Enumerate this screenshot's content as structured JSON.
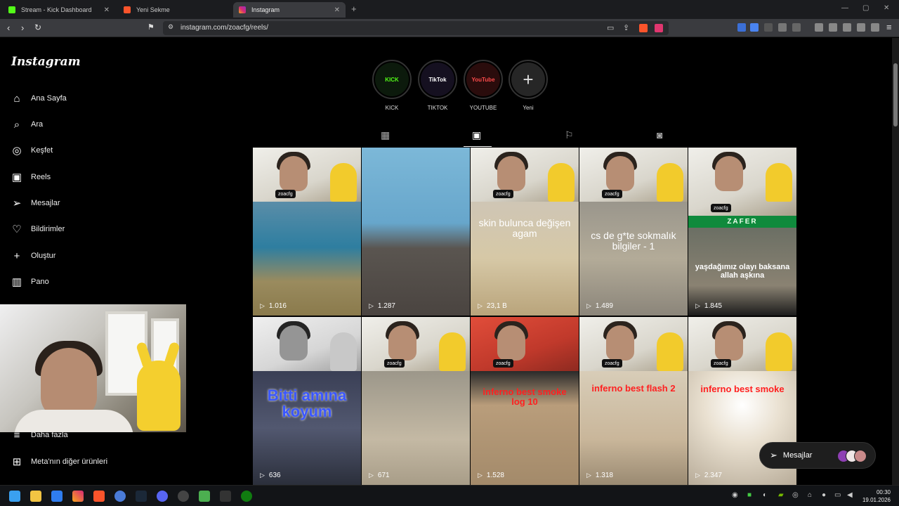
{
  "browser": {
    "tabs": [
      {
        "title": "Stream - Kick Dashboard",
        "active": false
      },
      {
        "title": "Yeni Sekme",
        "active": false
      },
      {
        "title": "Instagram",
        "active": true
      }
    ],
    "url": "instagram.com/zoacfg/reels/"
  },
  "instagram": {
    "logo": "Instagram",
    "nav": [
      {
        "label": "Ana Sayfa",
        "icon": "home-icon"
      },
      {
        "label": "Ara",
        "icon": "search-icon"
      },
      {
        "label": "Keşfet",
        "icon": "compass-icon"
      },
      {
        "label": "Reels",
        "icon": "reels-icon"
      },
      {
        "label": "Mesajlar",
        "icon": "messages-icon"
      },
      {
        "label": "Bildirimler",
        "icon": "heart-icon"
      },
      {
        "label": "Oluştur",
        "icon": "plus-icon"
      },
      {
        "label": "Pano",
        "icon": "dashboard-icon"
      }
    ],
    "nav_bottom": [
      {
        "label": "Daha fazla",
        "icon": "menu-icon"
      },
      {
        "label": "Meta'nın diğer ürünleri",
        "icon": "meta-apps-icon"
      }
    ],
    "highlights": [
      {
        "label": "KICK",
        "inner": "KICK",
        "color": "#53fc18"
      },
      {
        "label": "TIKTOK",
        "inner": "TikTok",
        "color": "#ffffff"
      },
      {
        "label": "YOUTUBE",
        "inner": "YouTube",
        "color": "#ff0000"
      },
      {
        "label": "Yeni",
        "inner": "+",
        "color": "#dddddd"
      }
    ],
    "profile_tabs": [
      "grid-icon",
      "reels-icon",
      "saved-icon",
      "tagged-icon"
    ],
    "reels": [
      {
        "views": "1.016",
        "caption": "",
        "bg": "#3f8fb0"
      },
      {
        "views": "1.287",
        "caption": "",
        "bg": "#6a8fb6"
      },
      {
        "views": "23,1 B",
        "caption": "skin bulunca değişen agam",
        "bg": "#b8a27c"
      },
      {
        "views": "1.489",
        "caption": "cs de g*te sokmalık bilgiler - 1",
        "bg": "#8e8a80"
      },
      {
        "views": "1.845",
        "caption": "yaşdağımız olayı baksana allah aşkına",
        "bg": "#6b6f64"
      },
      {
        "views": "636",
        "caption": "Bitti amına koyum",
        "bg": "#4a4f63"
      },
      {
        "views": "671",
        "caption": "",
        "bg": "#9a9385"
      },
      {
        "views": "1.528",
        "caption": "inferno best smoke log 10",
        "bg": "#a79479"
      },
      {
        "views": "1.318",
        "caption": "inferno best flash 2",
        "bg": "#c9b69a"
      },
      {
        "views": "2.347",
        "caption": "inferno best smoke",
        "bg": "#bfb3a2"
      }
    ],
    "overlay_tag": "zoacfg",
    "zafer_label": "ZAFER",
    "messages_pill": "Mesajlar"
  },
  "taskbar": {
    "time": "00:30",
    "date": "19.01.2026"
  }
}
